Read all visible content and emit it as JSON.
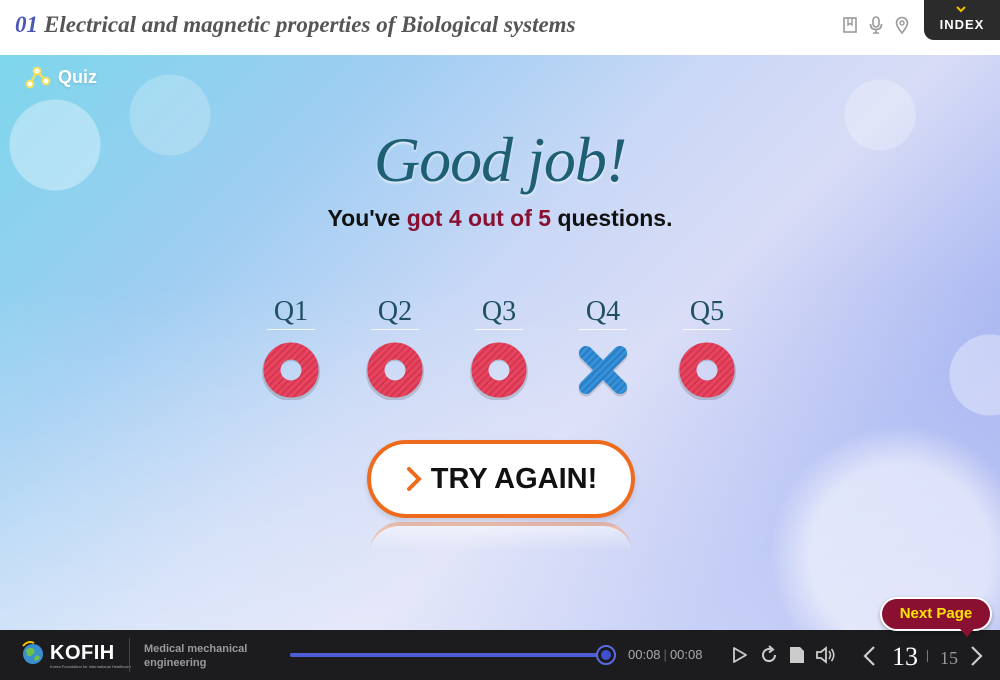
{
  "header": {
    "chapter_number": "01",
    "title": "Electrical and magnetic properties of Biological systems",
    "index_label": "INDEX",
    "icons": [
      "bookmark-icon",
      "microphone-icon",
      "location-pin-icon"
    ]
  },
  "quiz": {
    "label": "Quiz",
    "heading": "Good job!",
    "score_prefix": "You've",
    "score_highlight": "got 4 out of 5",
    "score_suffix": "questions.",
    "questions": [
      {
        "label": "Q1",
        "result": "correct"
      },
      {
        "label": "Q2",
        "result": "correct"
      },
      {
        "label": "Q3",
        "result": "correct"
      },
      {
        "label": "Q4",
        "result": "incorrect"
      },
      {
        "label": "Q5",
        "result": "correct"
      }
    ],
    "try_again_label": "TRY AGAIN!"
  },
  "next_page_label": "Next Page",
  "footer": {
    "brand": "KOFIH",
    "brand_tagline": "Korea Foundation for International Healthcare",
    "course_name": "Medical mechanical engineering",
    "progress": 1.0,
    "current_time": "00:08",
    "total_time": "00:08",
    "current_page": "13",
    "total_pages": "15"
  },
  "colors": {
    "accent_dark_red": "#8a1032",
    "orange": "#ee6a1c",
    "correct_red": "#e0405a",
    "incorrect_blue": "#2f86d0",
    "title_teal": "#1f5f74"
  }
}
